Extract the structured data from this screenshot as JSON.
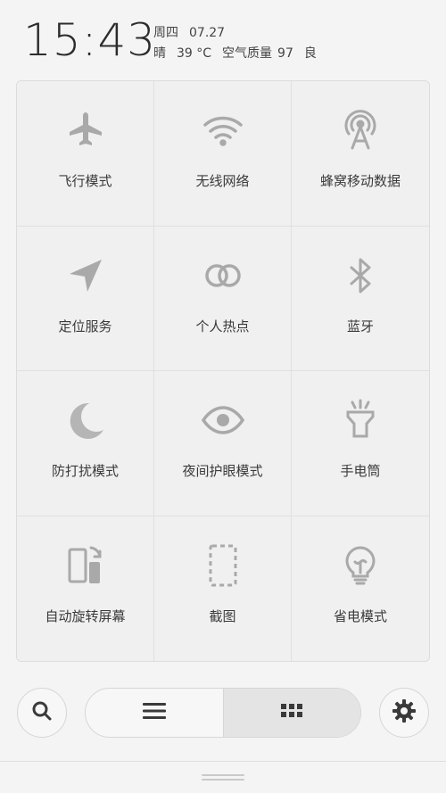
{
  "header": {
    "time": "15:43",
    "weekday": "周四",
    "date": "07.27",
    "weather": "晴",
    "temperature": "39 °C",
    "air_quality_label": "空气质量",
    "air_quality_value": "97",
    "air_quality_level": "良"
  },
  "tiles": [
    {
      "label": "飞行模式",
      "icon": "airplane-icon"
    },
    {
      "label": "无线网络",
      "icon": "wifi-icon"
    },
    {
      "label": "蜂窝移动数据",
      "icon": "cellular-tower-icon"
    },
    {
      "label": "定位服务",
      "icon": "location-arrow-icon"
    },
    {
      "label": "个人热点",
      "icon": "hotspot-rings-icon"
    },
    {
      "label": "蓝牙",
      "icon": "bluetooth-icon"
    },
    {
      "label": "防打扰模式",
      "icon": "moon-icon"
    },
    {
      "label": "夜间护眼模式",
      "icon": "eye-icon"
    },
    {
      "label": "手电筒",
      "icon": "flashlight-icon"
    },
    {
      "label": "自动旋转屏幕",
      "icon": "rotate-screen-icon"
    },
    {
      "label": "截图",
      "icon": "screenshot-icon"
    },
    {
      "label": "省电模式",
      "icon": "lightbulb-icon"
    }
  ],
  "bottom_bar": {
    "left_icon": "search-icon",
    "seg_left_icon": "list-icon",
    "seg_right_icon": "grid-icon",
    "right_icon": "gear-icon",
    "active_segment": "grid"
  },
  "colors": {
    "icon_gray": "#a9a9a9",
    "panel_bg": "#f0f0f0",
    "control_icon": "#3a3a3a"
  }
}
